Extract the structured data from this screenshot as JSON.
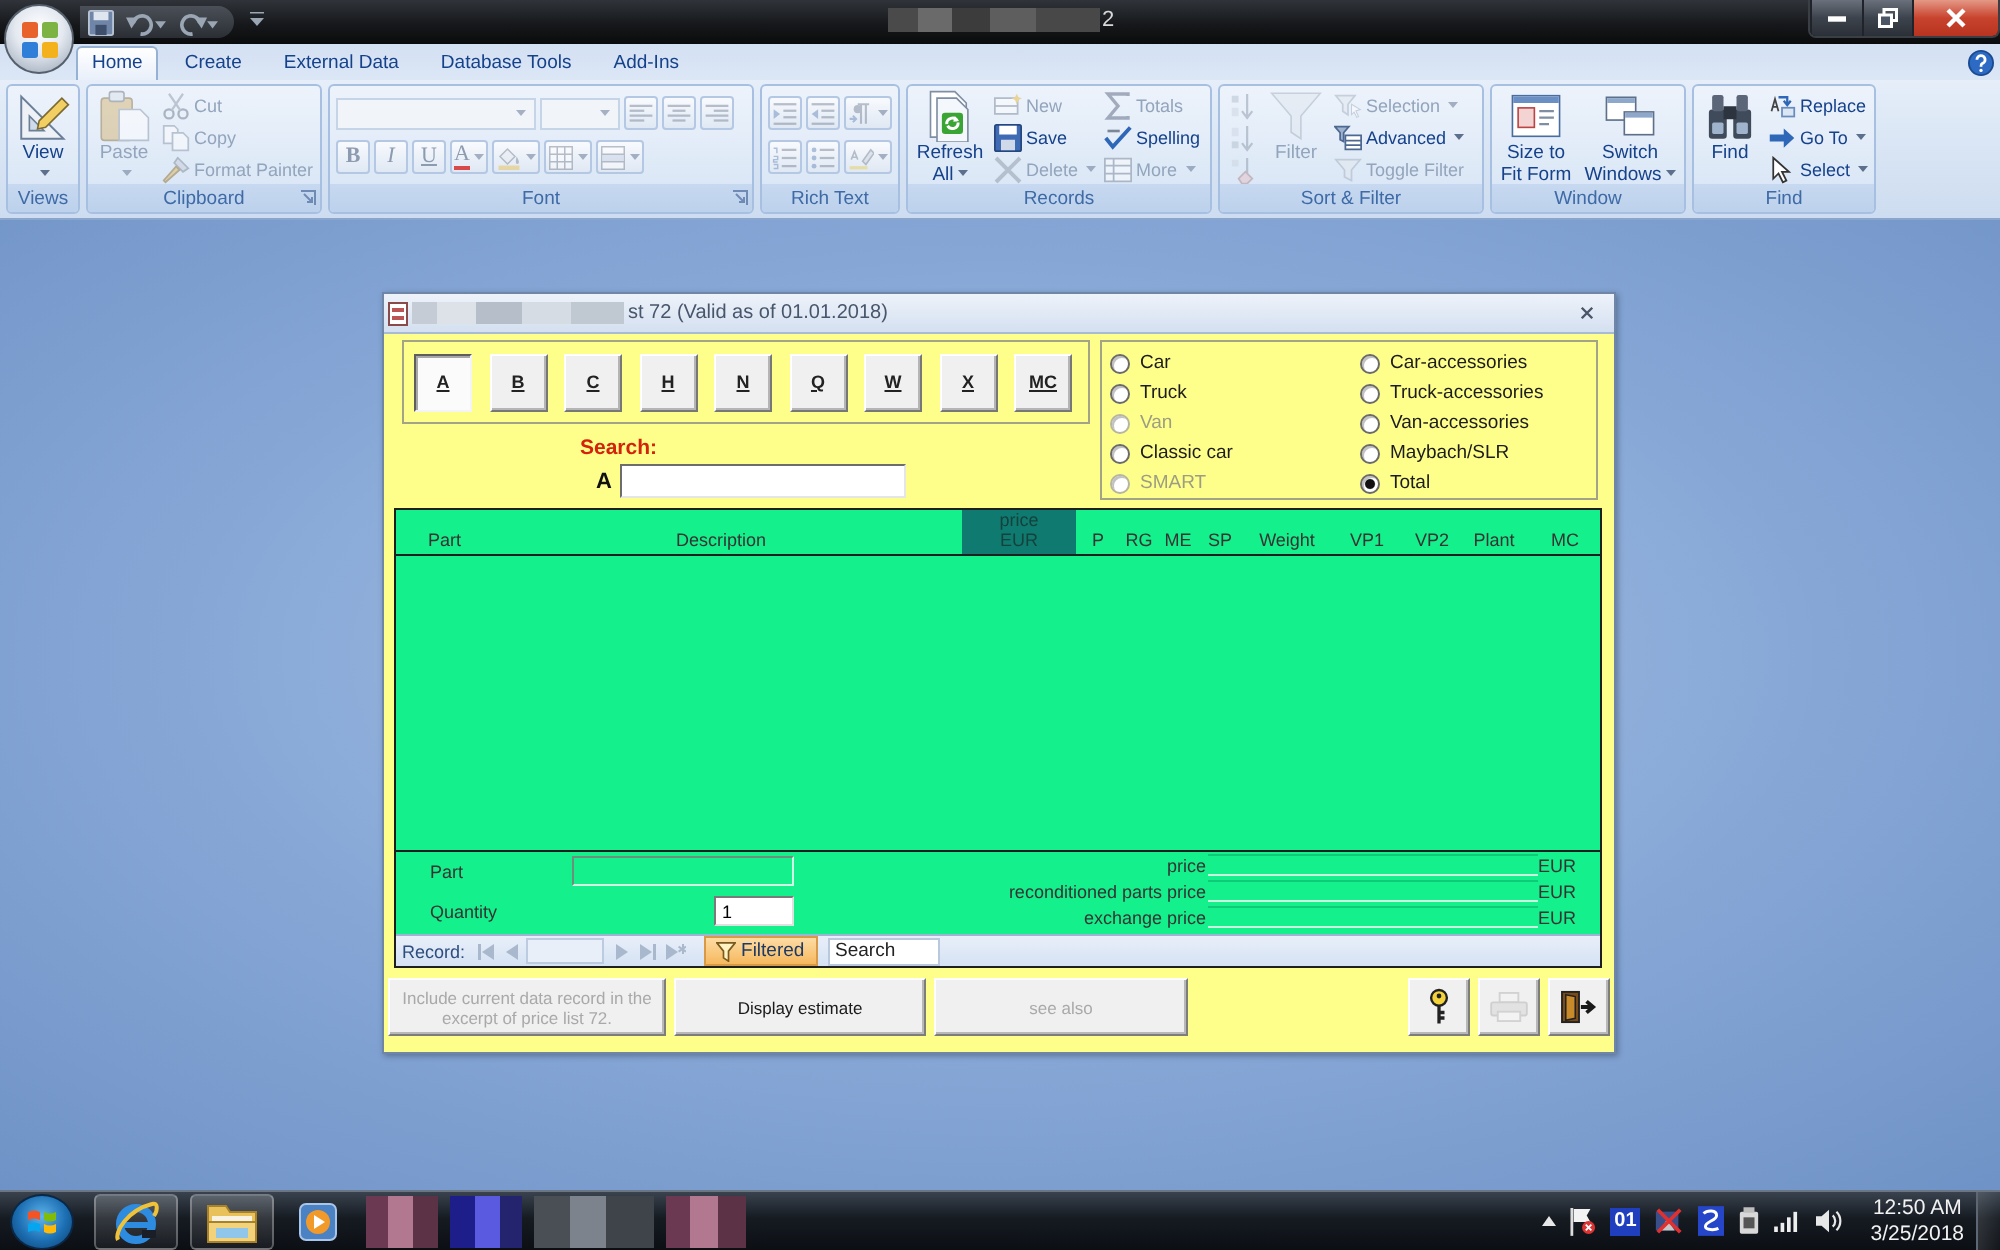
{
  "title_bar": {
    "title": "2"
  },
  "ribbon": {
    "tabs": [
      {
        "label": "Home",
        "selected": true
      },
      {
        "label": "Create",
        "selected": false
      },
      {
        "label": "External Data",
        "selected": false
      },
      {
        "label": "Database Tools",
        "selected": false
      },
      {
        "label": "Add-Ins",
        "selected": false
      }
    ],
    "groups": [
      {
        "label": "Views",
        "kind": "columns",
        "launcher": false,
        "sets": [
          [
            {
              "kind": "large",
              "label": "View",
              "disabled": false,
              "dropdown": true
            }
          ]
        ]
      },
      {
        "label": "Clipboard",
        "kind": "columns",
        "launcher": true,
        "sets": [
          [
            {
              "kind": "large",
              "label": "Paste",
              "disabled": true,
              "dropdown": true
            }
          ],
          [
            {
              "kind": "small",
              "label": "Cut",
              "disabled": true,
              "dropdown": false
            },
            {
              "kind": "small",
              "label": "Copy",
              "disabled": true,
              "dropdown": false
            },
            {
              "kind": "small",
              "label": "Format Painter",
              "disabled": true,
              "dropdown": false
            }
          ]
        ]
      },
      {
        "label": "Font",
        "kind": "rows",
        "launcher": true,
        "sets": [
          [
            {
              "kind": "combo",
              "disabled": true,
              "dropdown": true
            },
            {
              "kind": "combo",
              "disabled": true,
              "dropdown": true
            },
            {
              "kind": "tool",
              "disabled": true,
              "dropdown": false
            },
            {
              "kind": "tool",
              "disabled": true,
              "dropdown": false
            },
            {
              "kind": "tool",
              "disabled": true,
              "dropdown": false
            }
          ],
          [
            {
              "kind": "bold",
              "label": "B",
              "disabled": true,
              "dropdown": false
            },
            {
              "kind": "italic",
              "label": "I",
              "disabled": true,
              "dropdown": false
            },
            {
              "kind": "underline",
              "label": "U",
              "disabled": true,
              "dropdown": false
            },
            {
              "kind": "font-color",
              "label": "A",
              "disabled": true,
              "dropdown": true
            },
            {
              "kind": "tool",
              "disabled": true,
              "dropdown": true
            },
            {
              "kind": "tool",
              "disabled": true,
              "dropdown": true
            },
            {
              "kind": "tool",
              "disabled": true,
              "dropdown": true
            }
          ]
        ]
      },
      {
        "label": "Rich Text",
        "kind": "rows",
        "launcher": false,
        "sets": [
          [
            {
              "kind": "tool",
              "disabled": true,
              "dropdown": false
            },
            {
              "kind": "tool",
              "disabled": true,
              "dropdown": false
            },
            {
              "kind": "tool",
              "disabled": true,
              "dropdown": true
            }
          ],
          [
            {
              "kind": "tool",
              "disabled": true,
              "dropdown": false
            },
            {
              "kind": "tool",
              "disabled": true,
              "dropdown": false
            },
            {
              "kind": "tool",
              "disabled": true,
              "dropdown": true
            }
          ]
        ]
      },
      {
        "label": "Records",
        "kind": "columns",
        "launcher": false,
        "sets": [
          [
            {
              "kind": "large",
              "label": "Refresh All",
              "disabled": false,
              "dropdown": true
            }
          ],
          [
            {
              "kind": "small",
              "label": "New",
              "disabled": true,
              "dropdown": false
            },
            {
              "kind": "small",
              "label": "Save",
              "disabled": false,
              "dropdown": false
            },
            {
              "kind": "small",
              "label": "Delete",
              "disabled": true,
              "dropdown": true
            }
          ],
          [
            {
              "kind": "small",
              "label": "Totals",
              "disabled": true,
              "dropdown": false
            },
            {
              "kind": "small",
              "label": "Spelling",
              "disabled": false,
              "dropdown": false
            },
            {
              "kind": "small",
              "label": "More",
              "disabled": true,
              "dropdown": true
            }
          ]
        ]
      },
      {
        "label": "Sort & Filter",
        "kind": "columns",
        "launcher": false,
        "sets": [
          [
            {
              "kind": "icon",
              "disabled": true,
              "dropdown": false
            },
            {
              "kind": "icon",
              "disabled": true,
              "dropdown": false
            },
            {
              "kind": "icon",
              "disabled": true,
              "dropdown": false
            }
          ],
          [
            {
              "kind": "large",
              "label": "Filter",
              "disabled": true,
              "dropdown": false
            }
          ],
          [
            {
              "kind": "small",
              "label": "Selection",
              "disabled": true,
              "dropdown": true
            },
            {
              "kind": "small",
              "label": "Advanced",
              "disabled": false,
              "dropdown": true
            },
            {
              "kind": "small",
              "label": "Toggle Filter",
              "disabled": true,
              "dropdown": false
            }
          ]
        ]
      },
      {
        "label": "Window",
        "kind": "columns",
        "launcher": false,
        "sets": [
          [
            {
              "kind": "large",
              "label": "Size to Fit Form",
              "disabled": false,
              "dropdown": false
            }
          ],
          [
            {
              "kind": "large",
              "label": "Switch Windows",
              "disabled": false,
              "dropdown": true
            }
          ]
        ]
      },
      {
        "label": "Find",
        "kind": "columns",
        "launcher": false,
        "sets": [
          [
            {
              "kind": "large",
              "label": "Find",
              "disabled": false,
              "dropdown": false
            }
          ],
          [
            {
              "kind": "small",
              "label": "Replace",
              "disabled": false,
              "dropdown": false
            },
            {
              "kind": "small",
              "label": "Go To",
              "disabled": false,
              "dropdown": true
            },
            {
              "kind": "small",
              "label": "Select",
              "disabled": false,
              "dropdown": true
            }
          ]
        ]
      }
    ]
  },
  "dialog": {
    "title": "st 72 (Valid as of 01.01.2018)",
    "letters": [
      {
        "label": "A",
        "selected": true
      },
      {
        "label": "B",
        "selected": false
      },
      {
        "label": "C",
        "selected": false
      },
      {
        "label": "H",
        "selected": false
      },
      {
        "label": "N",
        "selected": false
      },
      {
        "label": "Q",
        "selected": false
      },
      {
        "label": "W",
        "selected": false
      },
      {
        "label": "X",
        "selected": false
      },
      {
        "label": "MC",
        "selected": false
      }
    ],
    "search": {
      "label": "Search:",
      "prefix": "A"
    },
    "vehicle_types": [
      {
        "label": "Car",
        "selected": false,
        "disabled": false
      },
      {
        "label": "Truck",
        "selected": false,
        "disabled": false
      },
      {
        "label": "Van",
        "selected": false,
        "disabled": true
      },
      {
        "label": "Classic car",
        "selected": false,
        "disabled": false
      },
      {
        "label": "SMART",
        "selected": false,
        "disabled": true
      },
      {
        "label": "Car-accessories",
        "selected": false,
        "disabled": false
      },
      {
        "label": "Truck-accessories",
        "selected": false,
        "disabled": false
      },
      {
        "label": "Van-accessories",
        "selected": false,
        "disabled": false
      },
      {
        "label": "Maybach/SLR",
        "selected": false,
        "disabled": false
      },
      {
        "label": "Total",
        "selected": true,
        "disabled": false
      }
    ],
    "table": {
      "columns": [
        {
          "label": "Part",
          "highlighted": false
        },
        {
          "label": "Description",
          "highlighted": false
        },
        {
          "label": "price\nEUR",
          "highlighted": true
        },
        {
          "label": "P",
          "highlighted": false
        },
        {
          "label": "RG",
          "highlighted": false
        },
        {
          "label": "ME",
          "highlighted": false
        },
        {
          "label": "SP",
          "highlighted": false
        },
        {
          "label": "Weight",
          "highlighted": false
        },
        {
          "label": "VP1",
          "highlighted": false
        },
        {
          "label": "VP2",
          "highlighted": false
        },
        {
          "label": "Plant",
          "highlighted": false
        },
        {
          "label": "MC",
          "highlighted": false
        }
      ]
    },
    "detail": {
      "part_label": "Part",
      "quantity_label": "Quantity",
      "quantity": "1",
      "prices": [
        {
          "label": "price",
          "currency": "EUR"
        },
        {
          "label": "reconditioned parts price",
          "currency": "EUR"
        },
        {
          "label": "exchange price",
          "currency": "EUR"
        }
      ]
    },
    "navigation": {
      "record_label": "Record:",
      "filter_label": "Filtered",
      "filtered": true,
      "search_placeholder": "Search"
    },
    "actions": [
      {
        "kind": "text",
        "label": "Include current data record in the excerpt of price list 72.",
        "disabled": true
      },
      {
        "kind": "text",
        "label": "Display estimate",
        "disabled": false
      },
      {
        "kind": "text",
        "label": "see also",
        "disabled": true
      },
      {
        "kind": "icon",
        "disabled": false
      },
      {
        "kind": "icon",
        "disabled": true
      },
      {
        "kind": "icon",
        "disabled": false
      }
    ]
  },
  "taskbar": {
    "tray_badge": "01",
    "time": "12:50 AM",
    "date": "3/25/2018"
  }
}
